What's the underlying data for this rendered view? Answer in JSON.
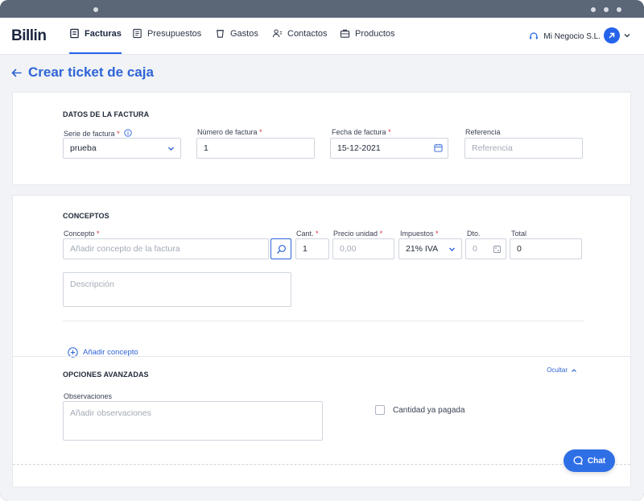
{
  "app": {
    "logo_text": "Billin",
    "nav": [
      {
        "label": "Facturas",
        "icon": "invoice-icon",
        "active": true
      },
      {
        "label": "Presupuestos",
        "icon": "budget-icon",
        "active": false
      },
      {
        "label": "Gastos",
        "icon": "expense-cup-icon",
        "active": false
      },
      {
        "label": "Contactos",
        "icon": "contacts-icon",
        "active": false
      },
      {
        "label": "Productos",
        "icon": "products-icon",
        "active": false
      }
    ],
    "company_name": "Mi Negocio S.L.",
    "accent_color": "#2563eb"
  },
  "page": {
    "title": "Crear ticket de caja"
  },
  "invoice_data": {
    "section_title": "DATOS DE LA FACTURA",
    "series_label": "Serie de factura",
    "series_value": "prueba",
    "number_label": "Número de factura",
    "number_value": "1",
    "date_label": "Fecha de factura",
    "date_value": "15-12-2021",
    "reference_label": "Referencia",
    "reference_placeholder": "Referencia"
  },
  "concepts": {
    "section_title": "CONCEPTOS",
    "concept_label": "Concepto",
    "concept_placeholder": "Añadir concepto de la factura",
    "qty_label": "Cant.",
    "qty_value": "1",
    "unit_price_label": "Precio unidad",
    "unit_price_placeholder": "0,00",
    "tax_label": "Impuestos",
    "tax_value": "21% IVA",
    "discount_label": "Dto.",
    "discount_placeholder": "0",
    "total_label": "Total",
    "total_value": "0",
    "description_placeholder": "Descripción",
    "add_concept_label": "Añadir concepto"
  },
  "advanced": {
    "section_title": "OPCIONES AVANZADAS",
    "toggle_label": "Ocultar",
    "observations_label": "Observaciones",
    "observations_placeholder": "Añadir observaciones",
    "paid_checkbox_label": "Cantidad ya pagada"
  },
  "chat": {
    "label": "Chat"
  }
}
